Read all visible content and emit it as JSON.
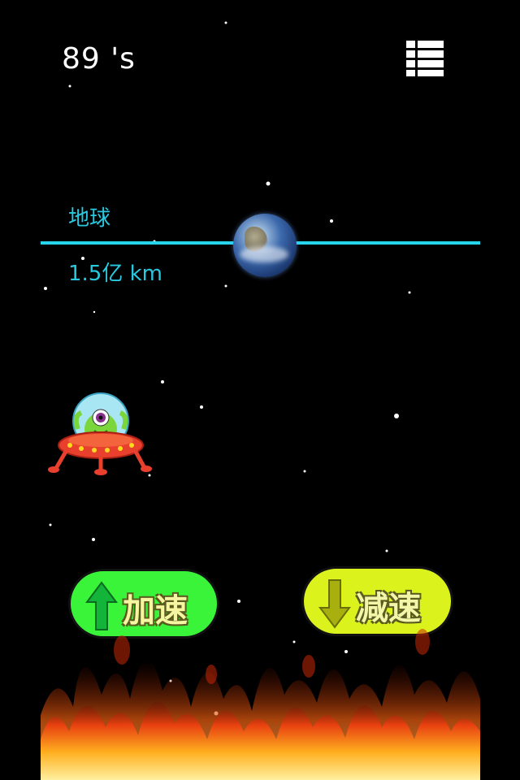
{
  "hud": {
    "timer_text": "89 's",
    "menu_icon": "list-menu-icon"
  },
  "planet": {
    "name": "地球",
    "distance": "1.5亿 km",
    "icon": "earth-icon",
    "line_color": "#27d4ec"
  },
  "player": {
    "icon": "ufo-alien-icon"
  },
  "controls": {
    "accelerate_label": "加速",
    "decelerate_label": "减速",
    "accelerate_color": "#3af43a",
    "decelerate_color": "#dcf21c"
  },
  "hazard": {
    "icon": "fire-icon"
  }
}
